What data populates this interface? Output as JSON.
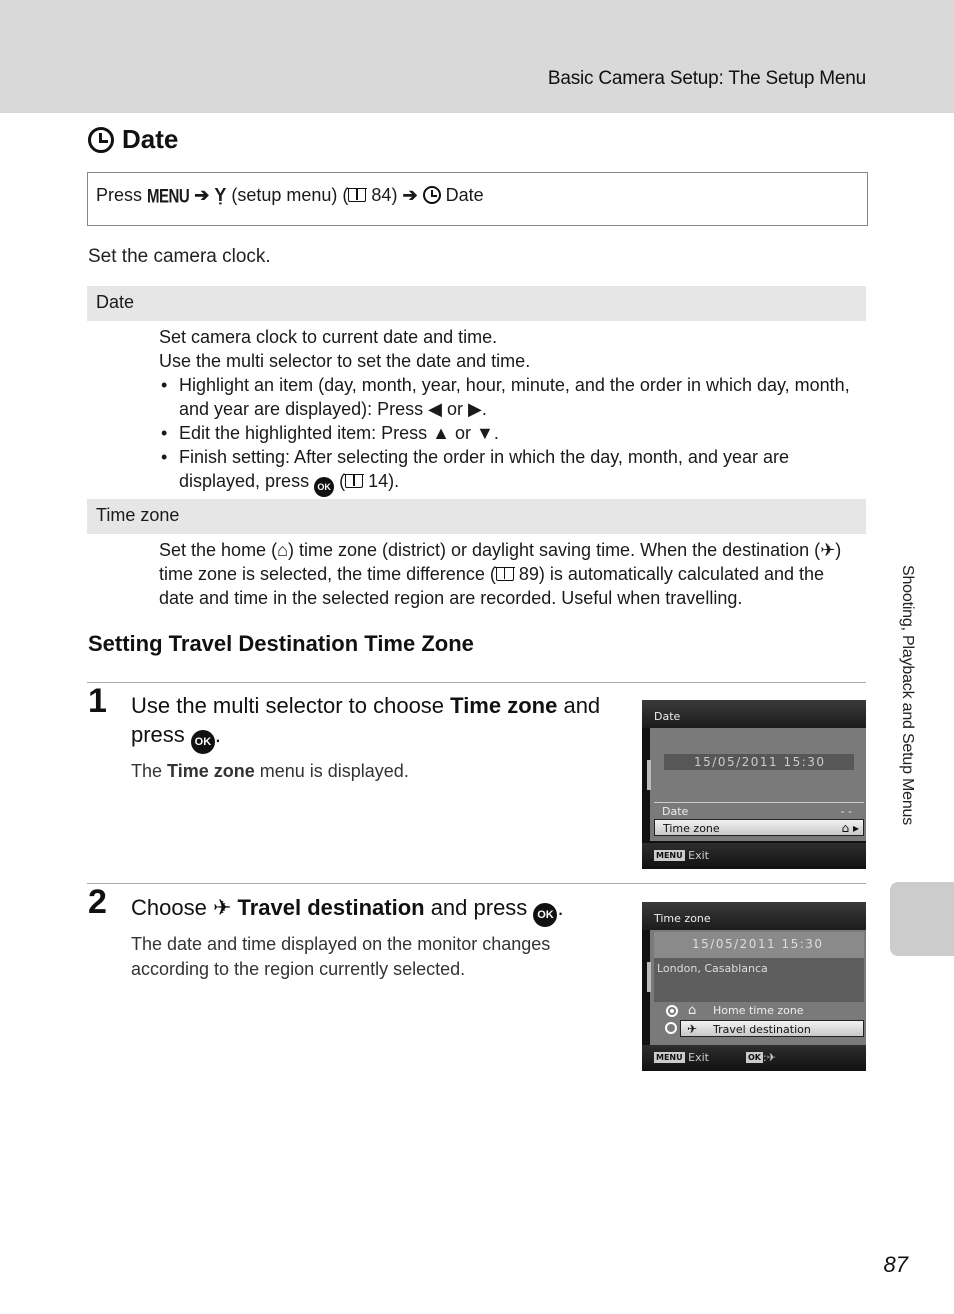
{
  "header": {
    "title": "Basic Camera Setup: The Setup Menu"
  },
  "page_title": {
    "icon": "clock-icon",
    "text": "Date"
  },
  "nav_path": {
    "press": "Press",
    "menu_key": "MENU",
    "setup_label": "(setup menu) (",
    "setup_page": "84)",
    "final": "Date"
  },
  "intro": "Set the camera clock.",
  "sections": [
    {
      "title": "Date",
      "lines": [
        "Set camera clock to current date and time.",
        "Use the multi selector to set the date and time."
      ],
      "bullets": [
        {
          "text": "Highlight an item (day, month, year, hour, minute, and the order in which day, month, and year are displayed): Press",
          "mid": "or",
          "end": "."
        },
        {
          "text": "Edit the highlighted item: Press",
          "mid": "or",
          "end": "."
        },
        {
          "text": "Finish setting: After selecting the order in which the day, month, and year are displayed, press",
          "ref": "14)."
        }
      ]
    },
    {
      "title": "Time zone",
      "text_a": "Set the home (",
      "text_b": ") time zone (district) or daylight saving time. When the destination (",
      "text_c": ") time zone is selected, the time difference (",
      "text_d": "89) is automatically calculated and the date and time in the selected region are recorded. Useful when travelling."
    }
  ],
  "subheading": "Setting Travel Destination Time Zone",
  "steps": [
    {
      "number": "1",
      "title_a": "Use the multi selector to choose ",
      "title_bold": "Time zone",
      "title_b": " and press",
      "desc_a": "The ",
      "desc_bold": "Time zone",
      "desc_b": " menu is displayed.",
      "screen": {
        "title": "Date",
        "datetime": "15/05/2011   15:30",
        "items": [
          {
            "label": "Date",
            "value": "- -",
            "selected": false
          },
          {
            "label": "Time zone",
            "value": "home-icon",
            "selected": true
          }
        ],
        "footer_key": "MENU",
        "footer_label": "Exit"
      }
    },
    {
      "number": "2",
      "title_a": "Choose ",
      "title_bold": "Travel destination",
      "title_b": " and press",
      "desc": "The date and time displayed on the monitor changes according to the region currently selected.",
      "screen": {
        "title": "Time zone",
        "datetime": "15/05/2011   15:30",
        "region": "London, Casablanca",
        "options": [
          {
            "label": "Home time zone",
            "icon": "home-icon",
            "checked": true,
            "selected": false
          },
          {
            "label": "Travel destination",
            "icon": "airplane-icon",
            "checked": false,
            "selected": true
          }
        ],
        "footer_key": "MENU",
        "footer_label": "Exit",
        "footer_ok": "OK"
      }
    }
  ],
  "side_tab": "Shooting, Playback and Setup Menus",
  "page_number": "87"
}
